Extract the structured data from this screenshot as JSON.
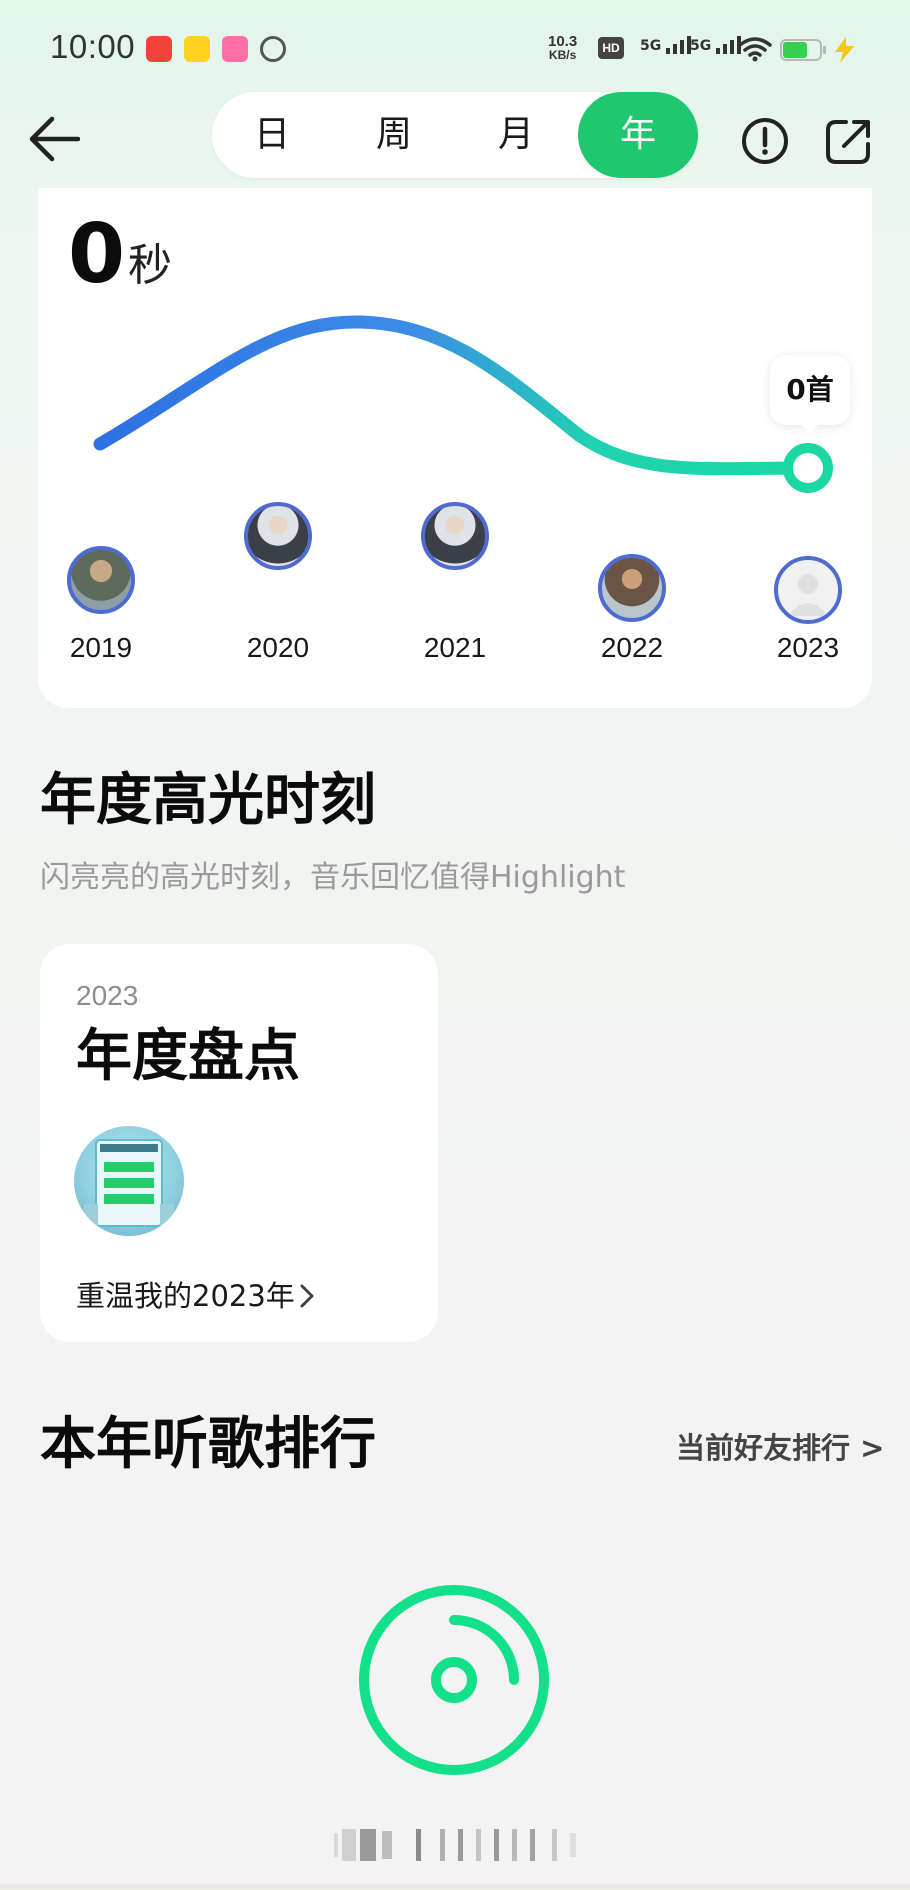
{
  "status_bar": {
    "time": "10:00",
    "net_speed": "10.3",
    "net_unit": "KB/s",
    "hd": "HD",
    "signal_1": "5G",
    "signal_2": "5G"
  },
  "header": {
    "tabs": [
      {
        "label": "日",
        "active": false
      },
      {
        "label": "周",
        "active": false
      },
      {
        "label": "月",
        "active": false
      },
      {
        "label": "年",
        "active": true
      }
    ],
    "accent_color": "#1ec770"
  },
  "chart_card": {
    "duration_value": "0",
    "duration_unit": "秒",
    "tooltip": "0首",
    "years": [
      "2019",
      "2020",
      "2021",
      "2022",
      "2023"
    ]
  },
  "highlights": {
    "title": "年度高光时刻",
    "subtitle": "闪亮亮的高光时刻，音乐回忆值得Highlight",
    "card": {
      "year": "2023",
      "title": "年度盘点",
      "link": "重温我的2023年"
    }
  },
  "ranking": {
    "title": "本年听歌排行",
    "friends_link": "当前好友排行 >"
  }
}
